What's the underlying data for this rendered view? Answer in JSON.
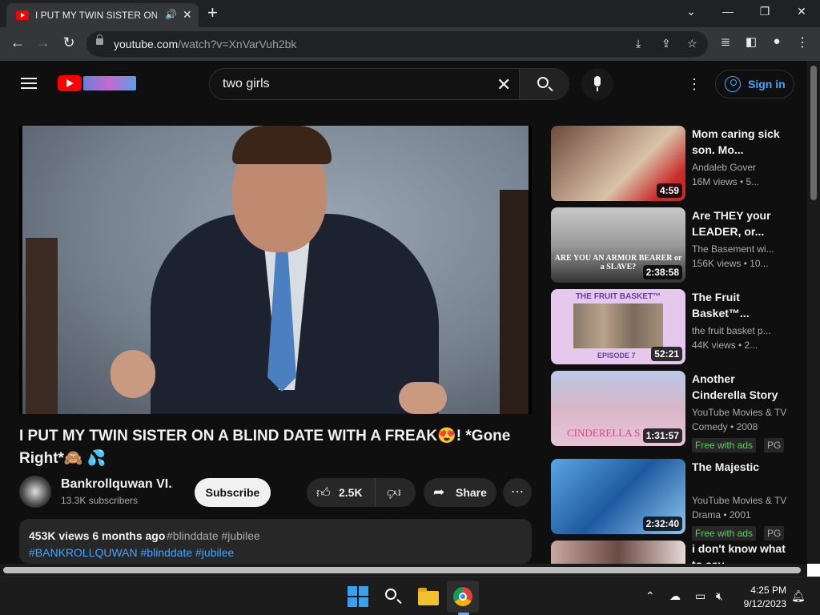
{
  "browser": {
    "tab_title": "I PUT MY TWIN SISTER ON A BLIND DATE WITH A FREAK",
    "url_host": "youtube.com",
    "url_path": "/watch?v=XnVarVuh2bk",
    "new_tab": "+",
    "minimize": "⌄",
    "restore": "—",
    "maximize": "❐",
    "close": "✕"
  },
  "youtube": {
    "search_query": "two girls",
    "signin_label": "Sign in",
    "video": {
      "title": "I PUT MY TWIN SISTER ON A BLIND DATE WITH A FREAK😍! *Gone Right*🙈 💦",
      "channel": "Bankrollquwan VI...",
      "subscribers": "13.3K subscribers",
      "subscribe_label": "Subscribe",
      "likes": "2.5K",
      "share_label": "Share",
      "views_age": "453K views  6 months ago",
      "tags_line1": "#blinddate #jubilee",
      "tags_line2": "#BANKROLLQUWAN #blinddate #jubilee"
    },
    "recommendations": [
      {
        "title": "Mom caring sick son. Mo...",
        "channel": "Andaleb Gover",
        "meta": "16M views  • 5...",
        "duration": "4:59"
      },
      {
        "title": "Are THEY your LEADER, or...",
        "channel": "The Basement wi...",
        "meta": "156K views  • 10...",
        "duration": "2:38:58",
        "thumb_text": "ARE YOU AN ARMOR BEARER or a SLAVE?"
      },
      {
        "title": "The Fruit Basket™...",
        "channel": "the fruit basket p...",
        "meta": "44K views  • 2...",
        "duration": "52:21",
        "thumb_text": "THE FRUIT BASKET™",
        "thumb_text2": "EPISODE 7"
      },
      {
        "title": "Another Cinderella Story",
        "channel": "YouTube Movies & TV",
        "meta": "Comedy • 2008",
        "duration": "1:31:57",
        "badge": "Free with ads",
        "rating": "PG",
        "thumb_text": "CINDERELLA S"
      },
      {
        "title": "The Majestic",
        "channel": "YouTube Movies & TV",
        "meta": "Drama • 2001",
        "duration": "2:32:40",
        "badge": "Free with ads",
        "rating": "PG"
      },
      {
        "title": "i don't know what to say",
        "channel": "",
        "meta": "",
        "duration": ""
      }
    ]
  },
  "taskbar": {
    "time": "4:25 PM",
    "date": "9/12/2023"
  }
}
